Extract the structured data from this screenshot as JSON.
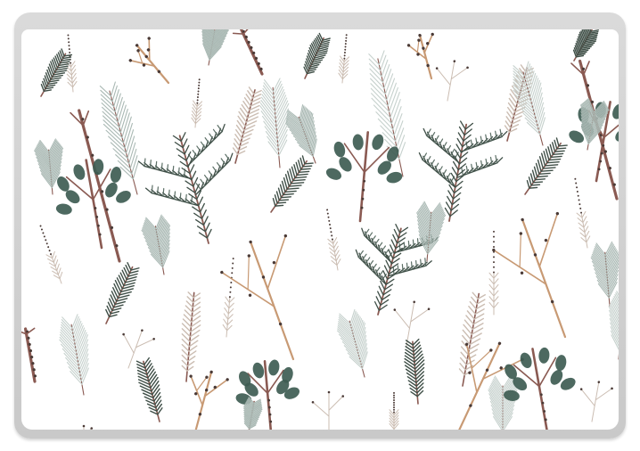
{
  "product": {
    "kind": "laptop-skin-preview",
    "pattern": "watercolor-winter-botanicals"
  },
  "palette": {
    "background": "#ffffff",
    "shell": "#d3d3d3",
    "pine_dark": "#3f4f47",
    "pine_mid": "#5c6f66",
    "sage": "#aab9b4",
    "sage_light": "#c6d1cd",
    "stem_brown": "#8a5a52",
    "twig_tan": "#c89a74",
    "bud": "#4a3a36",
    "needle_beige": "#cbbdb2",
    "eucalyptus": "#3e5c52"
  },
  "icons": {
    "sprigs": [
      "pine-branch-icon",
      "fir-sprig-icon",
      "sage-frond-icon",
      "eucalyptus-stem-icon",
      "bare-twig-icon",
      "berry-twig-icon",
      "dotted-stem-icon"
    ]
  }
}
